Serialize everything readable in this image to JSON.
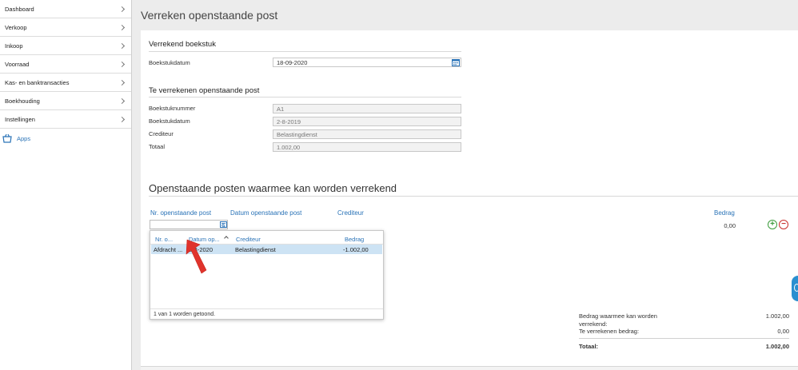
{
  "sidebar": {
    "items": [
      {
        "label": "Dashboard"
      },
      {
        "label": "Verkoop"
      },
      {
        "label": "Inkoop"
      },
      {
        "label": "Voorraad"
      },
      {
        "label": "Kas- en banktransacties"
      },
      {
        "label": "Boekhouding"
      },
      {
        "label": "Instellingen"
      }
    ],
    "apps_label": "Apps"
  },
  "page_title": "Verreken openstaande post",
  "verrekend_boekstuk": {
    "section_title": "Verrekend boekstuk",
    "boekstukdatum_label": "Boekstukdatum",
    "boekstukdatum_value": "18-09-2020"
  },
  "te_verrekenen": {
    "section_title": "Te verrekenen openstaande post",
    "fields": [
      {
        "label": "Boekstuknummer",
        "value": "A1"
      },
      {
        "label": "Boekstukdatum",
        "value": "2-8-2019"
      },
      {
        "label": "Crediteur",
        "value": "Belastingdienst"
      },
      {
        "label": "Totaal",
        "value": "1.002,00"
      }
    ]
  },
  "openstaande": {
    "title": "Openstaande posten waarmee kan worden verrekend",
    "columns": {
      "nr": "Nr. openstaande post",
      "datum": "Datum openstaande post",
      "crediteur": "Crediteur",
      "bedrag": "Bedrag"
    },
    "amount": "0,00",
    "add_symbol": "+",
    "remove_symbol": "−"
  },
  "dropdown": {
    "headers": {
      "nr": "Nr. o...",
      "datum": "Datum op...",
      "crediteur": "Crediteur",
      "bedrag": "Bedrag"
    },
    "row": {
      "nr": "Afdracht ...",
      "datum": "2-8-2020",
      "crediteur": "Belastingdienst",
      "bedrag": "-1.002,00"
    },
    "footer": "1 van 1 worden getoond."
  },
  "summary": {
    "line1_label_a": "Bedrag waarmee kan worden",
    "line1_label_b": "verrekend:",
    "line1_value": "1.002,00",
    "line2_label": "Te verrekenen bedrag:",
    "line2_value": "0,00",
    "total_label": "Totaal:",
    "total_value": "1.002,00"
  },
  "colors": {
    "accent": "#2a73b7",
    "selected_row": "#cde3f4",
    "add": "#3b9b3b",
    "remove": "#c9302c",
    "annotation_arrow": "#e0332c"
  }
}
